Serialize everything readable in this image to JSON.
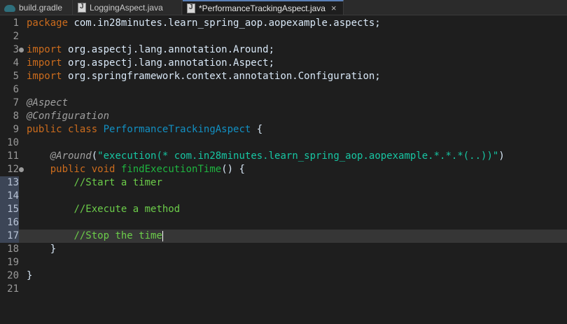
{
  "tabs": [
    {
      "label": "build.gradle",
      "icon": "gradle-icon"
    },
    {
      "label": "LoggingAspect.java",
      "icon": "java-file-icon"
    },
    {
      "label": "*PerformanceTrackingAspect.java",
      "icon": "java-file-icon",
      "active": true,
      "close": "×"
    }
  ],
  "lines": [
    {
      "n": "1",
      "t": [
        [
          "kw",
          "package"
        ],
        [
          "p",
          " com.in28minutes.learn_spring_aop.aopexample.aspects;"
        ]
      ]
    },
    {
      "n": "2",
      "t": []
    },
    {
      "n": "3",
      "t": [
        [
          "kw",
          "import"
        ],
        [
          "p",
          " org.aspectj.lang.annotation.Around;"
        ]
      ]
    },
    {
      "n": "4",
      "t": [
        [
          "kw",
          "import"
        ],
        [
          "p",
          " org.aspectj.lang.annotation.Aspect;"
        ]
      ]
    },
    {
      "n": "5",
      "t": [
        [
          "kw",
          "import"
        ],
        [
          "p",
          " org.springframework.context.annotation.Configuration;"
        ]
      ]
    },
    {
      "n": "6",
      "t": []
    },
    {
      "n": "7",
      "t": [
        [
          "ann",
          "@Aspect"
        ]
      ]
    },
    {
      "n": "8",
      "t": [
        [
          "ann",
          "@Configuration"
        ]
      ]
    },
    {
      "n": "9",
      "t": [
        [
          "kw",
          "public"
        ],
        [
          "p",
          " "
        ],
        [
          "kw",
          "class"
        ],
        [
          "p",
          " "
        ],
        [
          "cls",
          "PerformanceTrackingAspect"
        ],
        [
          "p",
          " {"
        ]
      ]
    },
    {
      "n": "10",
      "t": []
    },
    {
      "n": "11",
      "t": [
        [
          "p",
          "    "
        ],
        [
          "ann",
          "@Around"
        ],
        [
          "p",
          "("
        ],
        [
          "str",
          "\"execution(* com.in28minutes.learn_spring_aop.aopexample.*.*.*(..))\""
        ],
        [
          "p",
          ")"
        ]
      ]
    },
    {
      "n": "12",
      "t": [
        [
          "p",
          "    "
        ],
        [
          "kw",
          "public"
        ],
        [
          "p",
          " "
        ],
        [
          "kw",
          "void"
        ],
        [
          "p",
          " "
        ],
        [
          "fn",
          "findExecutionTime"
        ],
        [
          "p",
          "() {"
        ]
      ]
    },
    {
      "n": "13",
      "t": [
        [
          "p",
          "        "
        ],
        [
          "cm",
          "//Start a timer"
        ]
      ]
    },
    {
      "n": "14",
      "t": []
    },
    {
      "n": "15",
      "t": [
        [
          "p",
          "        "
        ],
        [
          "cm",
          "//Execute a method"
        ]
      ]
    },
    {
      "n": "16",
      "t": []
    },
    {
      "n": "17",
      "t": [
        [
          "p",
          "        "
        ],
        [
          "cm",
          "//Stop the time"
        ]
      ]
    },
    {
      "n": "18",
      "t": [
        [
          "p",
          "    }"
        ]
      ]
    },
    {
      "n": "19",
      "t": []
    },
    {
      "n": "20",
      "t": [
        [
          "p",
          "}"
        ]
      ]
    },
    {
      "n": "21",
      "t": []
    }
  ],
  "fold_lines": [
    "3",
    "12"
  ],
  "selected_gutter_lines": [
    "13",
    "14",
    "15",
    "16",
    "17"
  ],
  "current_line": "17",
  "colors": {
    "background": "#1e1e1e",
    "keyword": "#cc6c1d",
    "annotation": "#a0a0a0",
    "class_name": "#1290c3",
    "string": "#17c6a3",
    "method": "#1eb540",
    "comment": "#6ccd4a",
    "plain": "#d9e8f7"
  }
}
